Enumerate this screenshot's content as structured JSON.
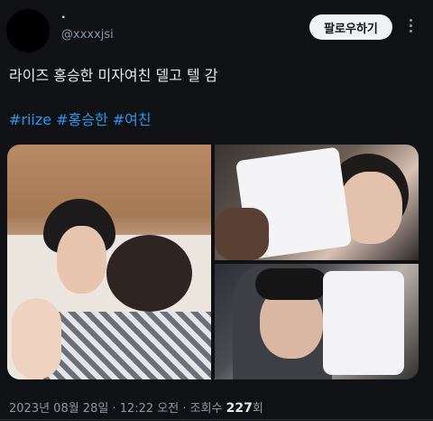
{
  "author": {
    "display_name": "·",
    "handle": "@xxxxjsi"
  },
  "follow_label": "팔로우하기",
  "more_icon": "more-vertical-icon",
  "tweet": {
    "text": "라이즈 홍승한 미자여친 델고 텔 감",
    "hashtags": [
      "#riize",
      "#홍승한",
      "#여친"
    ]
  },
  "media": [
    {
      "name": "photo-main"
    },
    {
      "name": "photo-top-right"
    },
    {
      "name": "photo-bottom-right"
    }
  ],
  "meta": {
    "timestamp": "2023년 08월 28일 · 12:22 오전 · 조회수 ",
    "views": "227",
    "views_suffix": "회"
  },
  "colors": {
    "background": "#0f1114",
    "link": "#1d9bf0",
    "muted": "#8b98a5",
    "button_bg": "#eff3f4"
  }
}
